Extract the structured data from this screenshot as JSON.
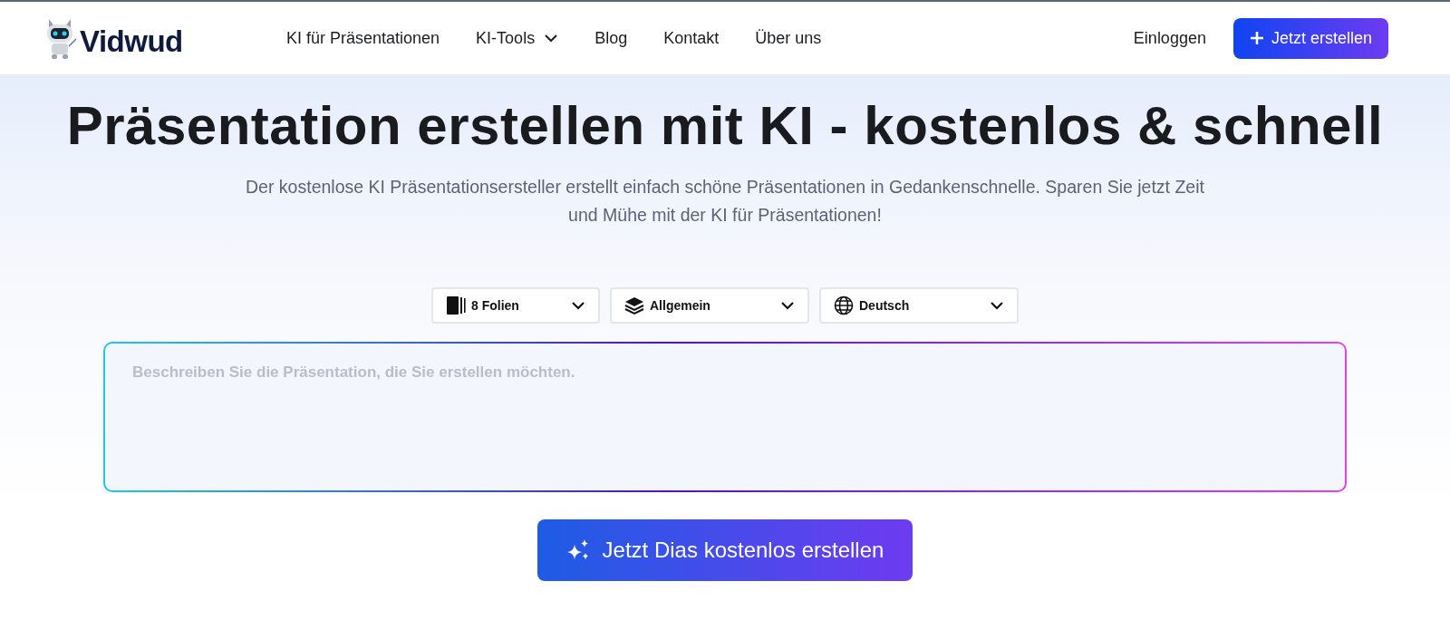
{
  "header": {
    "logo": "Vidwud",
    "nav": [
      {
        "label": "KI für Präsentationen",
        "has_menu": false
      },
      {
        "label": "KI-Tools",
        "has_menu": true
      },
      {
        "label": "Blog",
        "has_menu": false
      },
      {
        "label": "Kontakt",
        "has_menu": false
      },
      {
        "label": "Über uns",
        "has_menu": false
      }
    ],
    "login": "Einloggen",
    "cta": "Jetzt erstellen"
  },
  "hero": {
    "title": "Präsentation erstellen mit KI - kostenlos & schnell",
    "subtitle": "Der kostenlose KI Präsentationsersteller erstellt einfach schöne Präsentationen in Gedankenschnelle. Sparen Sie jetzt Zeit und Mühe mit der KI für Präsentationen!"
  },
  "options": [
    {
      "kind": "slides",
      "value": "8 Folien"
    },
    {
      "kind": "layers",
      "value": "Allgemein"
    },
    {
      "kind": "globe",
      "value": "Deutsch"
    }
  ],
  "prompt": {
    "placeholder": "Beschreiben Sie die Präsentation, die Sie erstellen möchten."
  },
  "generate_button": "Jetzt Dias kostenlos erstellen"
}
